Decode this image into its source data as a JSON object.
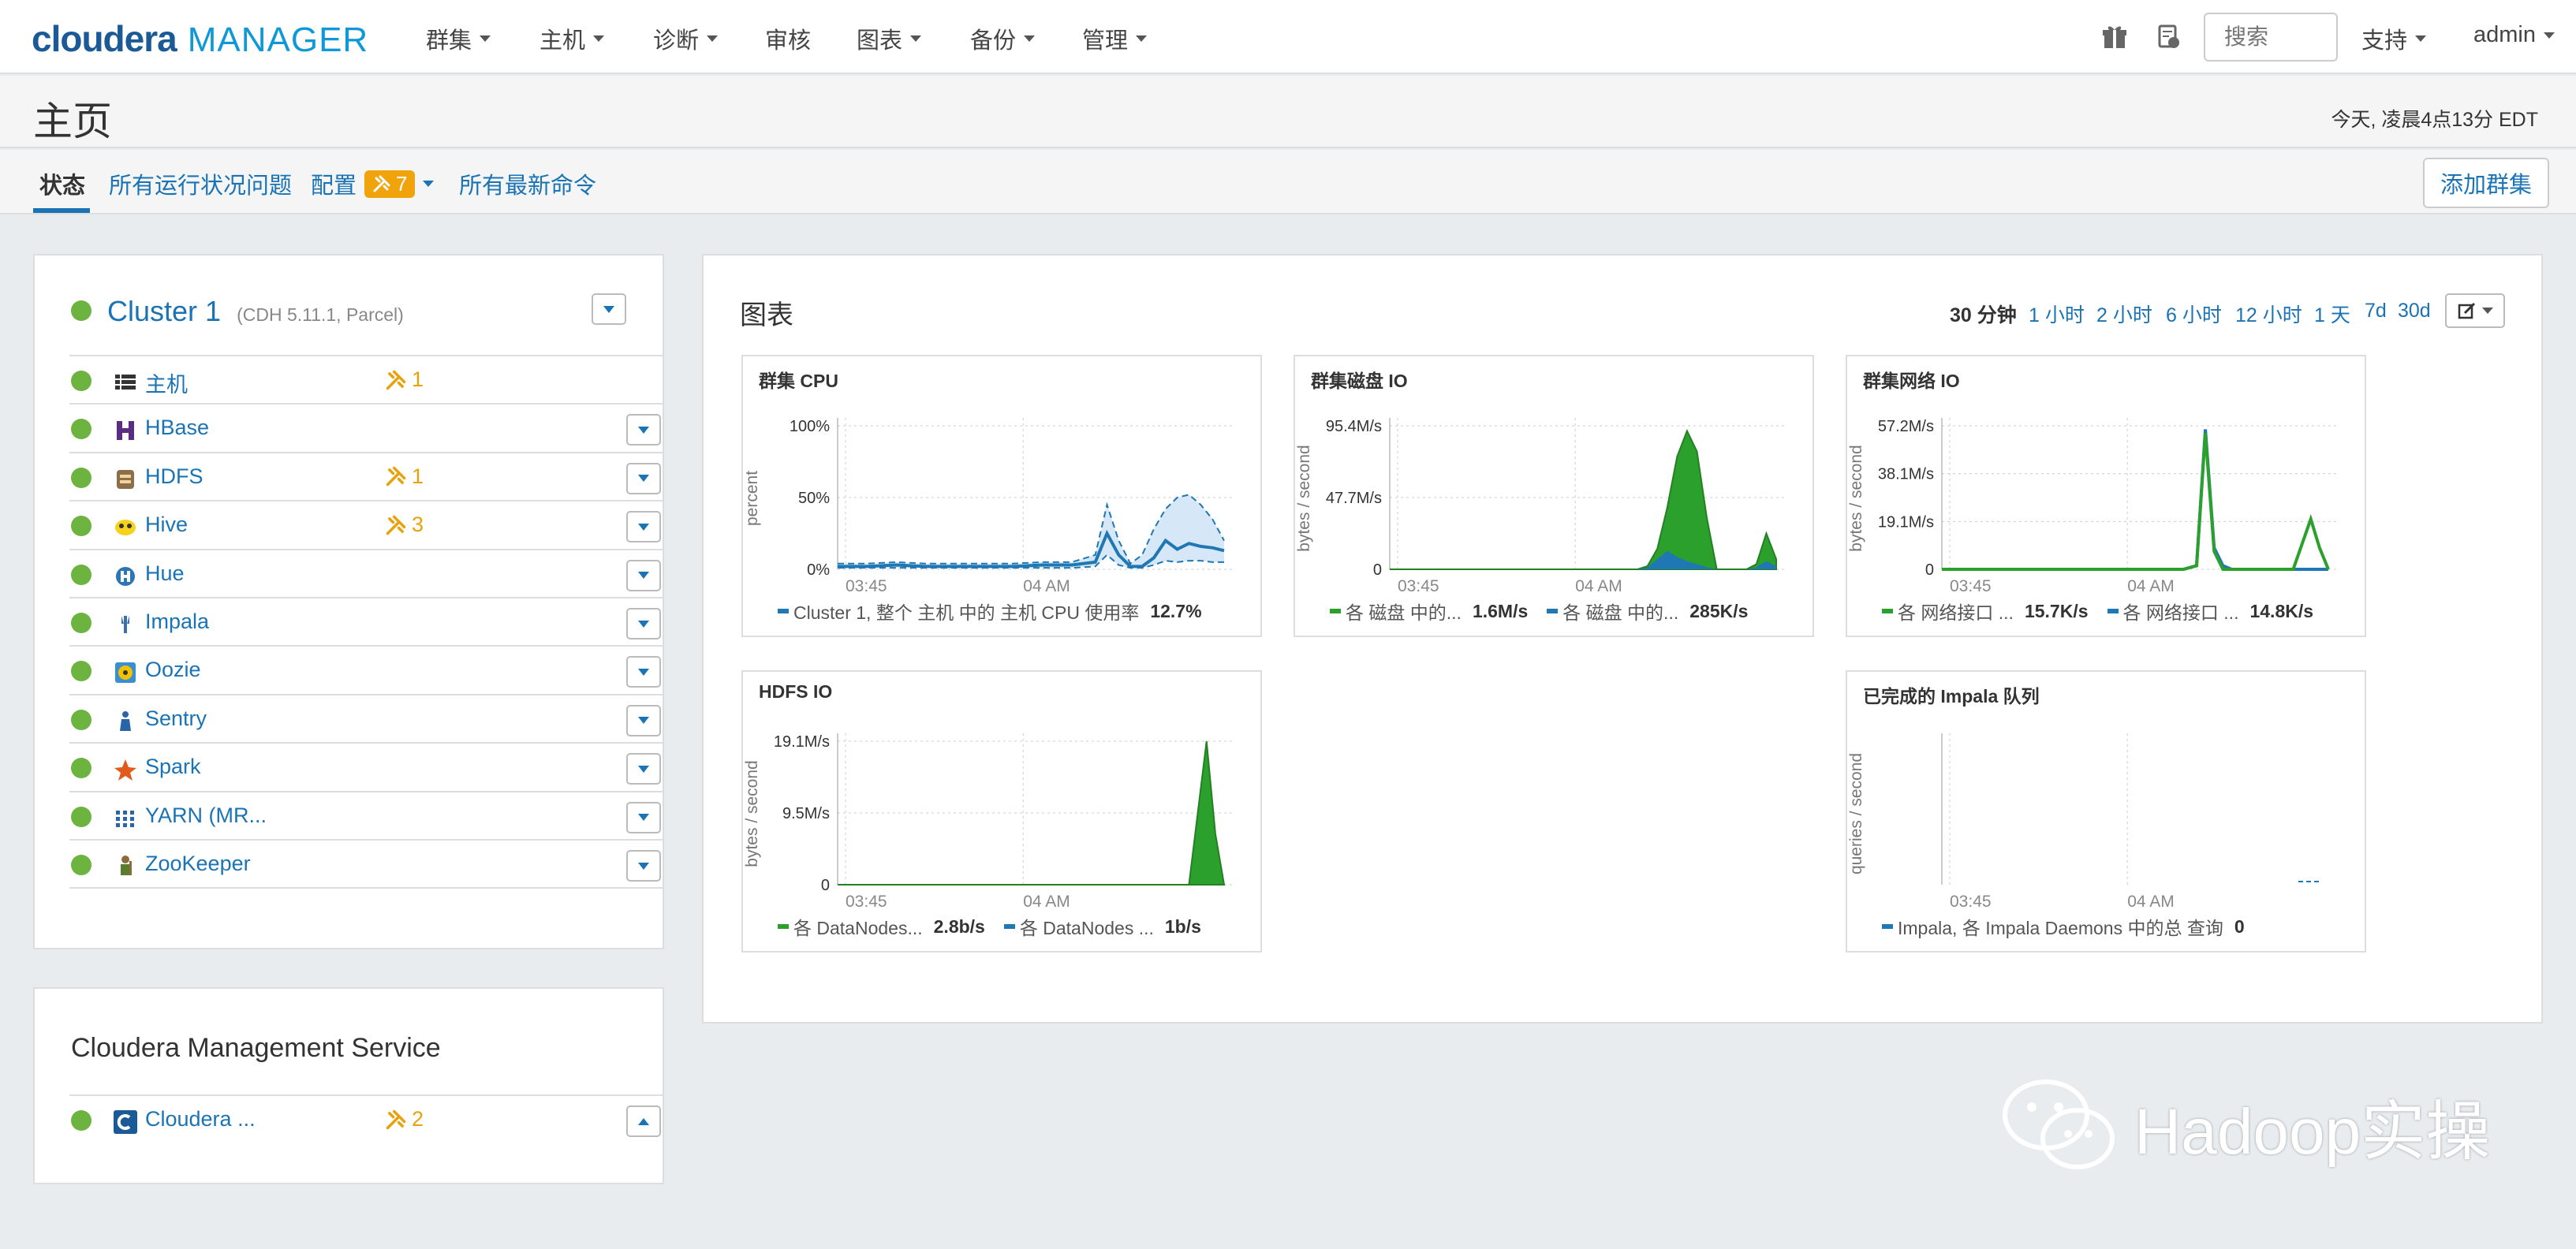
{
  "brand": {
    "name1": "cloudera",
    "name2": "MANAGER"
  },
  "nav": {
    "items": [
      "群集",
      "主机",
      "诊断",
      "审核",
      "图表",
      "备份",
      "管理"
    ],
    "audit_no_caret": "审核",
    "search_placeholder": "搜索",
    "support": "支持",
    "user": "admin"
  },
  "header": {
    "title": "主页",
    "time": "今天, 凌晨4点13分 EDT"
  },
  "tabs": {
    "status": "状态",
    "health_issues": "所有运行状况问题",
    "config": "配置",
    "config_count": "7",
    "recent_commands": "所有最新命令",
    "add_cluster": "添加群集"
  },
  "cluster": {
    "name": "Cluster 1",
    "version": "(CDH 5.11.1, Parcel)",
    "services": [
      {
        "name": "主机",
        "icon": "hosts-icon",
        "warn": "1"
      },
      {
        "name": "HBase",
        "icon": "hbase-icon",
        "warn": ""
      },
      {
        "name": "HDFS",
        "icon": "hdfs-icon",
        "warn": "1"
      },
      {
        "name": "Hive",
        "icon": "hive-icon",
        "warn": "3"
      },
      {
        "name": "Hue",
        "icon": "hue-icon",
        "warn": ""
      },
      {
        "name": "Impala",
        "icon": "impala-icon",
        "warn": ""
      },
      {
        "name": "Oozie",
        "icon": "oozie-icon",
        "warn": ""
      },
      {
        "name": "Sentry",
        "icon": "sentry-icon",
        "warn": ""
      },
      {
        "name": "Spark",
        "icon": "spark-icon",
        "warn": ""
      },
      {
        "name": "YARN (MR...",
        "icon": "yarn-icon",
        "warn": ""
      },
      {
        "name": "ZooKeeper",
        "icon": "zookeeper-icon",
        "warn": ""
      }
    ]
  },
  "cms": {
    "title": "Cloudera Management Service",
    "service": "Cloudera ...",
    "warn": "2"
  },
  "charts": {
    "title": "图表",
    "ranges": [
      "30 分钟",
      "1 小时",
      "2 小时",
      "6 小时",
      "12 小时",
      "1 天",
      "7d",
      "30d"
    ],
    "active_range": "30 分钟"
  },
  "colors": {
    "green": "#6db33f",
    "blue": "#1a73b5",
    "series_green": "#2ca02c",
    "series_blue": "#1f77b4",
    "warn": "#e8a20c"
  },
  "chart_data": [
    {
      "type": "line",
      "title": "群集 CPU",
      "ylabel": "percent",
      "yticks": [
        "100%",
        "50%",
        "0%"
      ],
      "xticks": [
        "03:45",
        "04 AM"
      ],
      "ylim": [
        0,
        100
      ],
      "series": [
        {
          "name": "Cluster 1, 整个 主机 中的 主机 CPU 使用率",
          "value_label": "12.7%"
        }
      ],
      "x": [
        0,
        10,
        20,
        30,
        40,
        50,
        60,
        70,
        80,
        88,
        92,
        96,
        100,
        104,
        108,
        112,
        116,
        120,
        124,
        128,
        132
      ],
      "values": [
        2,
        2,
        3,
        2,
        2,
        2,
        2,
        3,
        3,
        5,
        25,
        10,
        2,
        2,
        8,
        20,
        14,
        18,
        16,
        15,
        13
      ],
      "band_upper": [
        4,
        4,
        5,
        4,
        4,
        4,
        4,
        5,
        5,
        10,
        45,
        20,
        4,
        10,
        28,
        42,
        50,
        52,
        45,
        35,
        20
      ],
      "band_lower": [
        1,
        1,
        1,
        1,
        1,
        1,
        1,
        1,
        1,
        2,
        10,
        3,
        1,
        1,
        3,
        6,
        5,
        6,
        6,
        5,
        5
      ]
    },
    {
      "type": "area",
      "title": "群集磁盘 IO",
      "ylabel": "bytes / second",
      "yticks": [
        "95.4M/s",
        "47.7M/s",
        "0"
      ],
      "xticks": [
        "03:45",
        "04 AM"
      ],
      "ylim": [
        0,
        140
      ],
      "series": [
        {
          "name": "各 磁盘 中的...",
          "value_label": "1.6M/s"
        },
        {
          "name": "各 磁盘 中的...",
          "value_label": "285K/s"
        }
      ],
      "x": [
        0,
        30,
        60,
        90,
        100,
        104,
        108,
        112,
        116,
        120,
        124,
        128,
        132,
        136,
        140,
        144,
        148,
        152,
        156
      ],
      "values_green": [
        0,
        0,
        0,
        0,
        0,
        3,
        20,
        60,
        110,
        135,
        115,
        50,
        0,
        0,
        0,
        0,
        5,
        35,
        10
      ],
      "values_blue": [
        0,
        0,
        0,
        0,
        0,
        2,
        10,
        18,
        12,
        8,
        5,
        2,
        0,
        0,
        0,
        0,
        2,
        8,
        3
      ]
    },
    {
      "type": "line",
      "title": "群集网络 IO",
      "ylabel": "bytes / second",
      "yticks": [
        "57.2M/s",
        "38.1M/s",
        "19.1M/s",
        "0"
      ],
      "xticks": [
        "03:45",
        "04 AM"
      ],
      "ylim": [
        0,
        80
      ],
      "series": [
        {
          "name": "各 网络接口 ...",
          "value_label": "15.7K/s"
        },
        {
          "name": "各 网络接口 ...",
          "value_label": "14.8K/s"
        }
      ],
      "x": [
        0,
        30,
        60,
        90,
        110,
        116,
        120,
        124,
        128,
        132,
        140,
        150,
        160,
        168,
        172,
        176
      ],
      "values_green": [
        0,
        0,
        0,
        0,
        0,
        2,
        76,
        10,
        0,
        0,
        0,
        0,
        0,
        28,
        12,
        0
      ],
      "values_blue": [
        0,
        0,
        0,
        0,
        0,
        2,
        78,
        12,
        2,
        0,
        0,
        0,
        0,
        0,
        0,
        0
      ]
    },
    {
      "type": "area",
      "title": "HDFS IO",
      "ylabel": "bytes / second",
      "yticks": [
        "19.1M/s",
        "9.5M/s",
        "0"
      ],
      "xticks": [
        "03:45",
        "04 AM"
      ],
      "ylim": [
        0,
        28
      ],
      "series": [
        {
          "name": "各 DataNodes...",
          "value_label": "2.8b/s"
        },
        {
          "name": "各 DataNodes ...",
          "value_label": "1b/s"
        }
      ],
      "x": [
        0,
        30,
        60,
        90,
        120,
        150,
        160,
        168,
        172,
        176
      ],
      "values_green": [
        0,
        0,
        0,
        0,
        0,
        0,
        0,
        28,
        10,
        0
      ],
      "values_blue": [
        0,
        0,
        0,
        0,
        0,
        0,
        0,
        0,
        0,
        0
      ]
    },
    {
      "type": "line",
      "title": "已完成的 Impala 队列",
      "ylabel": "queries / second",
      "yticks": [],
      "xticks": [
        "03:45",
        "04 AM"
      ],
      "ylim": [
        0,
        1
      ],
      "series": [
        {
          "name": "Impala, 各 Impala Daemons 中的总 查询",
          "value_label": "0"
        }
      ],
      "x": [
        0,
        180
      ],
      "values": [
        0,
        0
      ]
    }
  ],
  "watermark": "Hadoop实操"
}
